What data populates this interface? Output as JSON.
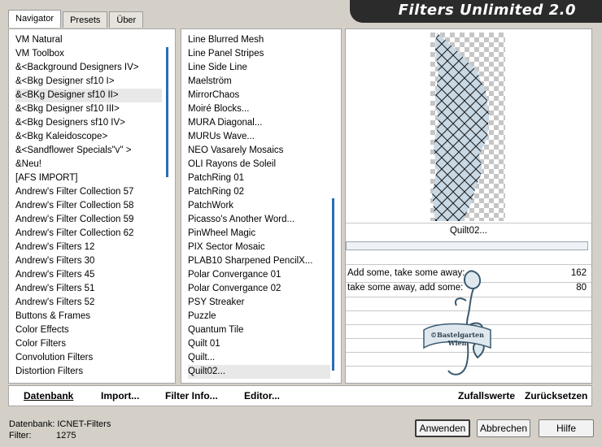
{
  "tabs": [
    {
      "label": "Navigator",
      "active": true
    },
    {
      "label": "Presets",
      "active": false
    },
    {
      "label": "Über",
      "active": false
    }
  ],
  "title": "Filters Unlimited 2.0",
  "categories": [
    "VM Natural",
    "VM Toolbox",
    "&<Background Designers IV>",
    "&<Bkg Designer sf10 I>",
    "&<BKg Designer sf10 II>",
    "&<Bkg Designer sf10 III>",
    "&<Bkg Designers sf10 IV>",
    "&<Bkg Kaleidoscope>",
    "&<Sandflower Specials\"v\" >",
    "&Neu!",
    "[AFS IMPORT]",
    "Andrew's Filter Collection 57",
    "Andrew's Filter Collection 58",
    "Andrew's Filter Collection 59",
    "Andrew's Filter Collection 62",
    "Andrew's Filters 12",
    "Andrew's Filters 30",
    "Andrew's Filters 45",
    "Andrew's Filters 51",
    "Andrew's Filters 52",
    "Buttons & Frames",
    "Color Effects",
    "Color Filters",
    "Convolution Filters",
    "Distortion Filters"
  ],
  "selected_category_index": 4,
  "filters": [
    "Line Blurred Mesh",
    "Line Panel Stripes",
    "Line Side Line",
    "Maelström",
    "MirrorChaos",
    "Moiré Blocks...",
    "MURA Diagonal...",
    "MURUs Wave...",
    "NEO Vasarely Mosaics",
    "OLI Rayons de Soleil",
    "PatchRing 01",
    "PatchRing 02",
    "PatchWork",
    "Picasso's Another Word...",
    "PinWheel Magic",
    "PIX Sector Mosaic",
    "PLAB10 Sharpened PencilX...",
    "Polar Convergance 01",
    "Polar Convergance 02",
    "PSY Streaker",
    "Puzzle",
    "Quantum Tile",
    "Quilt 01",
    "Quilt...",
    "Quilt02..."
  ],
  "selected_filter_index": 24,
  "preview_label": "Quilt02...",
  "params": [
    {
      "label": "Add some, take some away:",
      "value": "162"
    },
    {
      "label": "take some away, add some:",
      "value": "80"
    }
  ],
  "watermark_text": "©Bastelgarten Wien",
  "toolbar": {
    "database": "Datenbank",
    "import": "Import...",
    "filter_info": "Filter Info...",
    "editor": "Editor...",
    "random": "Zufallswerte",
    "reset": "Zurücksetzen"
  },
  "status": {
    "database_label": "Datenbank:",
    "database_value": "ICNET-Filters",
    "filter_label": "Filter:",
    "filter_value": "1275"
  },
  "buttons": {
    "apply": "Anwenden",
    "cancel": "Abbrechen",
    "help": "Hilfe"
  },
  "colors": {
    "accent": "#2c6db5",
    "title_bg": "#2b2b2b",
    "preview_fill": "#c8d8e4"
  }
}
